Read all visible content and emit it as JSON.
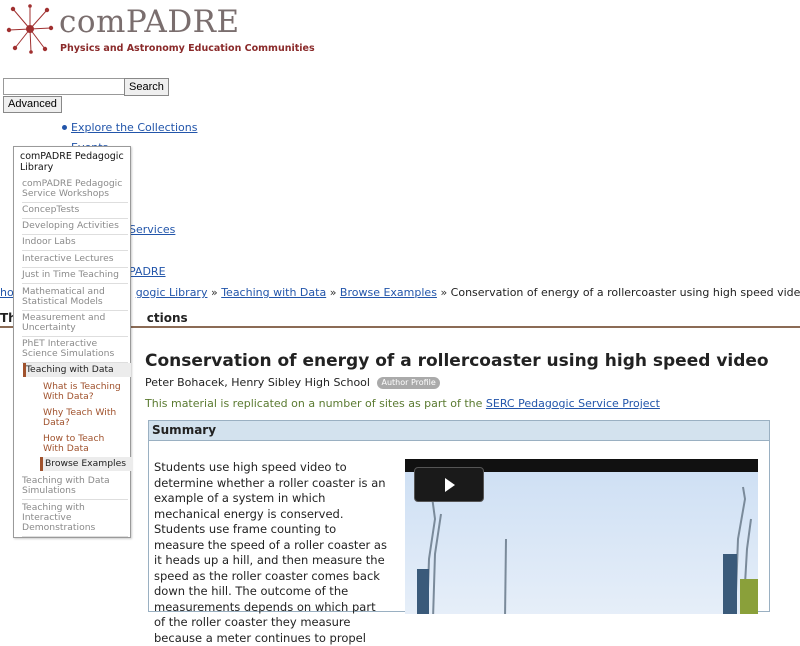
{
  "header": {
    "brand": "comPADRE",
    "tagline": "Physics and Astronomy Education Communities"
  },
  "search": {
    "input_value": "",
    "search_label": "Search",
    "advanced_label": "Advanced"
  },
  "nav": {
    "explore": "Explore the Collections",
    "events": "Events",
    "services_partial": "Services",
    "padre_partial": "PADRE"
  },
  "breadcrumb": {
    "home_partial": "ho",
    "library_partial": "gogic Library",
    "teaching": "Teaching with Data",
    "browse": "Browse Examples",
    "current": "Conservation of energy of a rollercoaster using high speed video",
    "separator": "»"
  },
  "section_title": {
    "left": "Th",
    "right": "ctions"
  },
  "material": {
    "title": "Conservation of energy of a rollercoaster using high speed video",
    "authors": "Peter Bohacek, Henry Sibley High School",
    "author_profile": "Author Profile",
    "replicated_text": "This material is replicated on a number of sites as part of the",
    "replicated_link": "SERC Pedagogic Service Project"
  },
  "summary": {
    "label": "Summary",
    "text": "Students use high speed video to determine whether a roller coaster is an example of a system in which mechanical energy is conserved. Students use frame counting to measure the speed of a roller coaster as it heads up a hill, and then measure the speed as the roller coaster comes back down the hill. The outcome of the measurements depends on which part of the roller coaster they measure because a meter continues to propel"
  },
  "sidebar": {
    "title": "comPADRE Pedagogic Library",
    "items": [
      "comPADRE Pedagogic Service Workshops",
      "ConcepTests",
      "Developing Activities",
      "Indoor Labs",
      "Interactive Lectures",
      "Just in Time Teaching",
      "Mathematical and Statistical Models",
      "Measurement and Uncertainty",
      "PhET Interactive Science Simulations"
    ],
    "active": "Teaching with Data",
    "subitems": [
      "What is Teaching With Data?",
      "Why Teach With Data?",
      "How to Teach With Data"
    ],
    "subactive": "Browse Examples",
    "after_items": [
      "Teaching with Data Simulations",
      "Teaching with Interactive Demonstrations"
    ]
  },
  "colors": {
    "link": "#2255aa",
    "brand_red": "#8a2a2a",
    "rule": "#8b6b55",
    "summary_header": "#d3e2ee"
  }
}
